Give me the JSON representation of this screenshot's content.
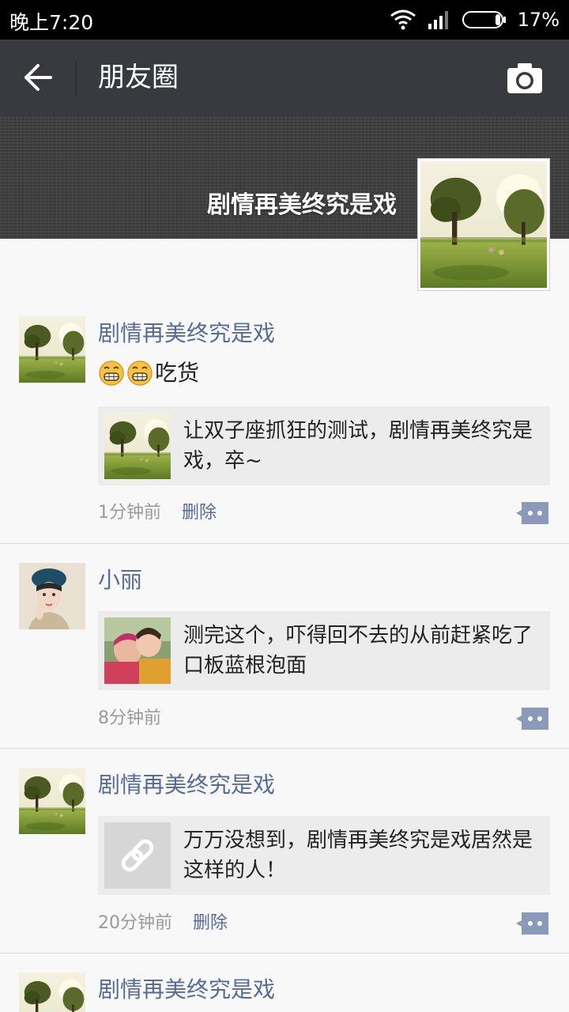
{
  "status_bar": {
    "time": "晚上7:20",
    "battery_pct": "17%"
  },
  "app_bar": {
    "title": "朋友圈"
  },
  "cover": {
    "name": "剧情再美终究是戏"
  },
  "posts": [
    {
      "author": "剧情再美终究是戏",
      "text": "吃货",
      "emoji_count": 2,
      "link_text": "让双子座抓狂的测试，剧情再美终究是戏，卒~",
      "time": "1分钟前",
      "delete_label": "删除"
    },
    {
      "author": "小丽",
      "link_text": "测完这个，吓得回不去的从前赶紧吃了口板蓝根泡面",
      "time": "8分钟前"
    },
    {
      "author": "剧情再美终究是戏",
      "link_text": "万万没想到，剧情再美终究是戏居然是这样的人！",
      "time": "20分钟前",
      "delete_label": "删除"
    },
    {
      "author": "剧情再美终究是戏"
    }
  ],
  "colors": {
    "app_bar": "#393a3f",
    "author": "#576b95",
    "status_bar": "#000000"
  },
  "icons": [
    "wifi-icon",
    "signal-icon",
    "battery-icon",
    "back-arrow-icon",
    "camera-icon",
    "comment-icon",
    "link-icon",
    "grimace-emoji-icon"
  ]
}
